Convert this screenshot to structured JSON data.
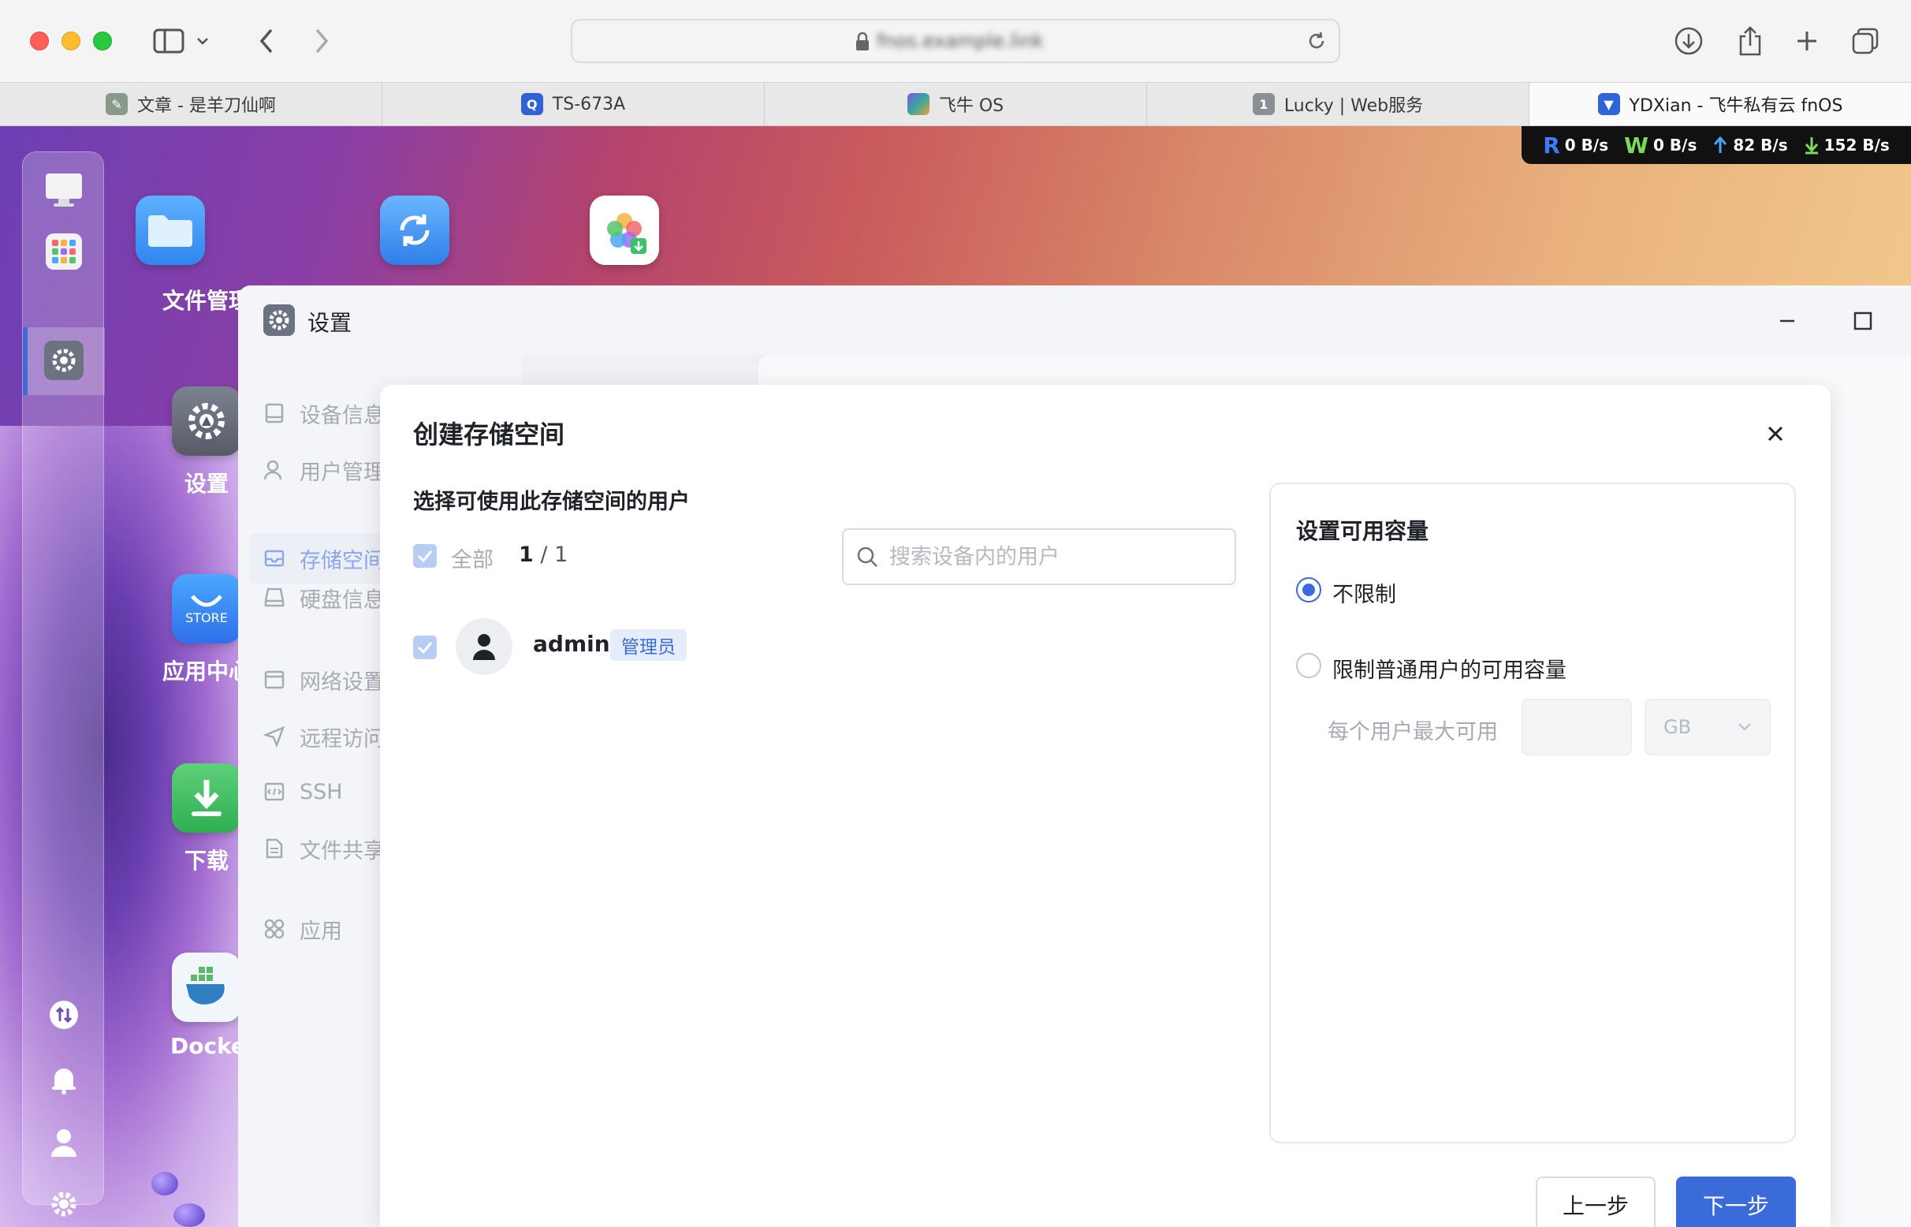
{
  "browser": {
    "address": "fnos.example.link",
    "tabs": [
      {
        "label": "文章 - 是羊刀仙啊",
        "favicon_color": "#8a9a8a",
        "icon": "article-favicon"
      },
      {
        "label": "TS-673A",
        "favicon_color": "#2f63d8",
        "icon": "qnap-favicon"
      },
      {
        "label": "飞牛 OS",
        "favicon_color": "#3aa6a0",
        "icon": "fnos-favicon"
      },
      {
        "label": "Lucky | Web服务",
        "favicon_color": "#8a8e95",
        "icon": "lucky-favicon",
        "favicon_text": "1"
      },
      {
        "label": "YDXian - 飞牛私有云 fnOS",
        "favicon_color": "#2f63d8",
        "icon": "ydxian-favicon"
      }
    ],
    "active_tab": 4
  },
  "speed": {
    "read_label": "R",
    "read": "0 B/s",
    "write_label": "W",
    "write": "0 B/s",
    "upload": "82 B/s",
    "download": "152 B/s",
    "colors": {
      "read": "#3f7bff",
      "write": "#7ed957",
      "upload": "#4fa3ff",
      "download": "#7ed957"
    }
  },
  "desktop": {
    "apps": [
      {
        "label": "文件管理",
        "icon": "folder-icon"
      },
      {
        "label": "设置",
        "icon": "settings-gear-icon"
      },
      {
        "label": "应用中心",
        "icon": "app-store-icon",
        "sub": "STORE"
      },
      {
        "label": "下载",
        "icon": "download-icon"
      },
      {
        "label": "Docker",
        "icon": "docker-icon"
      }
    ]
  },
  "window": {
    "title": "设置",
    "sidebar": [
      {
        "label": "设备信息",
        "icon": "device-icon"
      },
      {
        "label": "用户管理",
        "icon": "user-icon"
      },
      {
        "label": "存储空间",
        "icon": "storage-icon",
        "active": true
      },
      {
        "label": "硬盘信息",
        "icon": "disk-icon"
      },
      {
        "label": "网络设置",
        "icon": "network-icon"
      },
      {
        "label": "远程访问",
        "icon": "remote-icon"
      },
      {
        "label": "SSH",
        "icon": "ssh-icon"
      },
      {
        "label": "文件共享",
        "icon": "file-share-icon"
      },
      {
        "label": "应用",
        "icon": "apps-icon"
      }
    ]
  },
  "dialog": {
    "title": "创建存储空间",
    "users_section_title": "选择可使用此存储空间的用户",
    "select_all_label": "全部",
    "selected_count": "1",
    "total_count": "/ 1",
    "search_placeholder": "搜索设备内的用户",
    "users": [
      {
        "name": "admin",
        "badge": "管理员",
        "checked": true
      }
    ],
    "capacity": {
      "title": "设置可用容量",
      "option_unlimited": "不限制",
      "option_limit": "限制普通用户的可用容量",
      "per_user_label": "每个用户最大可用",
      "unit": "GB",
      "selected": "unlimited"
    },
    "buttons": {
      "prev": "上一步",
      "next": "下一步"
    }
  },
  "colors": {
    "accent": "#3a6bd8"
  }
}
